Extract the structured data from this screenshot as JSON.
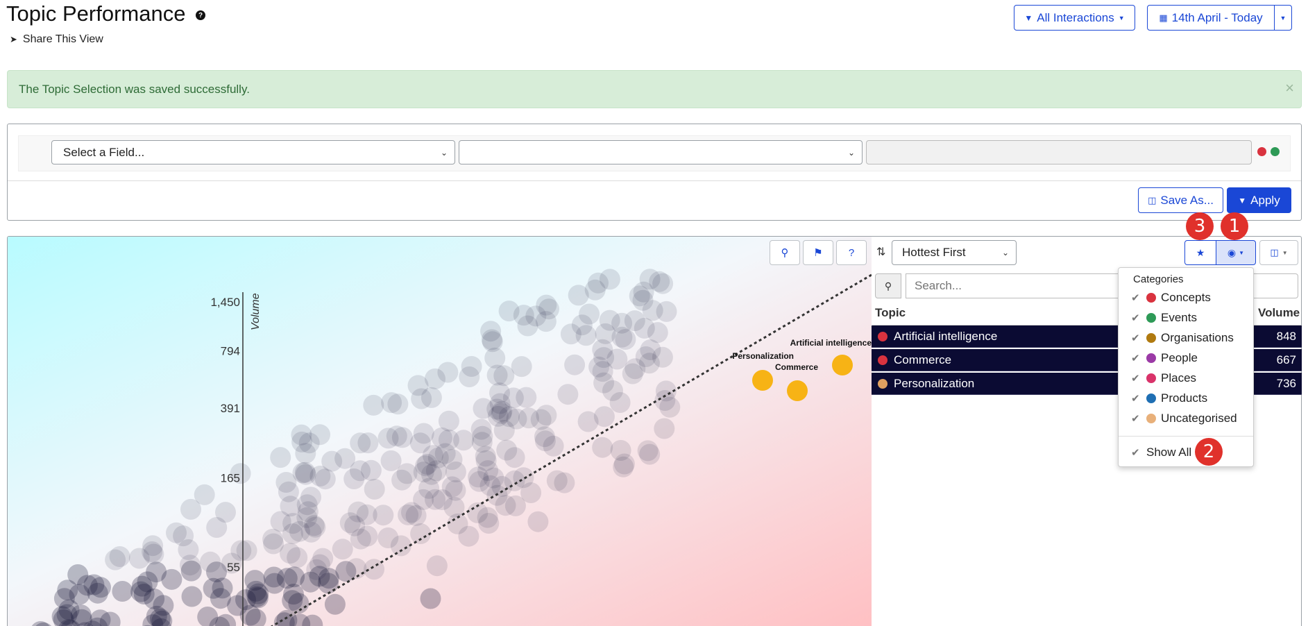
{
  "header": {
    "title": "Topic Performance",
    "share_label": "Share This View",
    "interactions_label": "All Interactions",
    "date_label": "14th April - Today"
  },
  "alert": {
    "message": "The Topic Selection was saved successfully.",
    "close": "×"
  },
  "filter": {
    "field_placeholder": "Select a Field...",
    "operator_value": "",
    "value_text": "",
    "save_as_label": "Save As...",
    "apply_label": "Apply"
  },
  "chart_toolbar": {
    "help_label": "?",
    "sort_value": "Hottest First",
    "search_placeholder": "Search..."
  },
  "annotations": [
    "3",
    "1",
    "2"
  ],
  "chart_data": {
    "type": "scatter",
    "ylabel": "Volume",
    "y_ticks": [
      "1,450",
      "794",
      "391",
      "165",
      "55"
    ],
    "highlighted": [
      {
        "label": "Artificial intelligence",
        "volume": 848
      },
      {
        "label": "Commerce",
        "volume": 667
      },
      {
        "label": "Personalization",
        "volume": 736
      }
    ],
    "colors": {
      "highlight": "#f7b315",
      "point": "#1a1a3a",
      "bg_left": "#b8fbff",
      "bg_right": "#ffc9cc"
    }
  },
  "table": {
    "col_topic": "Topic",
    "col_volume": "Volume",
    "rows": [
      {
        "topic": "Artificial intelligence",
        "volume": "848",
        "icon": "concept-icon",
        "color": "#d9333f"
      },
      {
        "topic": "Commerce",
        "volume": "667",
        "icon": "concept-icon",
        "color": "#d9333f"
      },
      {
        "topic": "Personalization",
        "volume": "736",
        "icon": "uncategorised-icon",
        "color": "#e0a060"
      }
    ]
  },
  "categories_menu": {
    "heading": "Categories",
    "items": [
      {
        "label": "Concepts",
        "color": "#d9333f"
      },
      {
        "label": "Events",
        "color": "#2e9a57"
      },
      {
        "label": "Organisations",
        "color": "#b07a10"
      },
      {
        "label": "People",
        "color": "#9b3aa6"
      },
      {
        "label": "Places",
        "color": "#d9336a"
      },
      {
        "label": "Products",
        "color": "#1f6fb3"
      },
      {
        "label": "Uncategorised",
        "color": "#e8b07a"
      }
    ],
    "show_all": "Show All"
  }
}
